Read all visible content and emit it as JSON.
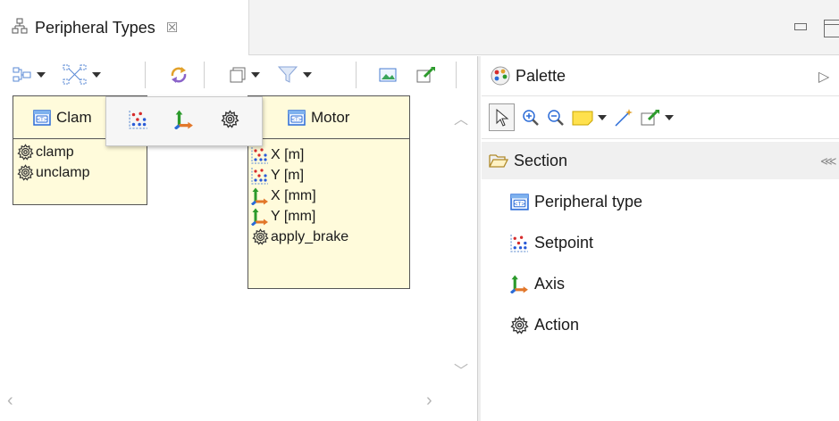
{
  "view_tab": {
    "title": "Peripheral Types",
    "close_glyph": "☒"
  },
  "canvas": {
    "clamp_node": {
      "name": "Clam",
      "actions": [
        "clamp",
        "unclamp"
      ]
    },
    "motor_node": {
      "name": "Motor",
      "setpoints": [
        "X [m]",
        "Y [m]"
      ],
      "axes": [
        "X [mm]",
        "Y [mm]"
      ],
      "actions": [
        "apply_brake"
      ]
    },
    "popup": {
      "icons": [
        "setpoint-icon",
        "axis-icon",
        "action-icon"
      ]
    }
  },
  "palette": {
    "title": "Palette",
    "drawer": "Section",
    "items": [
      {
        "label": "Peripheral type",
        "icon": "peripheral-type-icon"
      },
      {
        "label": "Setpoint",
        "icon": "setpoint-icon"
      },
      {
        "label": "Axis",
        "icon": "axis-icon"
      },
      {
        "label": "Action",
        "icon": "action-icon"
      }
    ]
  },
  "colors": {
    "node_fill": "#fffbdb",
    "setpoint_red": "#d62c2c",
    "setpoint_blue": "#2a5bd7",
    "axis_orange": "#e2772a",
    "axis_green": "#2b9a2b",
    "axis_blue": "#2a6bd7"
  }
}
